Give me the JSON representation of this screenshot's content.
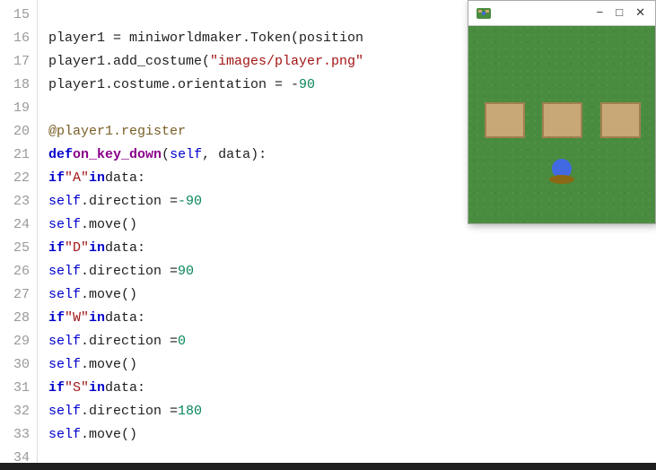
{
  "editor": {
    "lines": [
      {
        "num": "15",
        "content": []
      },
      {
        "num": "16",
        "content": [
          {
            "type": "plain",
            "text": "player1 = miniworldmaker.Token(position"
          }
        ]
      },
      {
        "num": "17",
        "content": [
          {
            "type": "plain",
            "text": "player1.add_costume("
          },
          {
            "type": "str",
            "text": "\"images/player.png\""
          }
        ]
      },
      {
        "num": "18",
        "content": [
          {
            "type": "plain",
            "text": "player1.costume.orientation = - "
          },
          {
            "type": "num",
            "text": "90"
          }
        ]
      },
      {
        "num": "19",
        "content": []
      },
      {
        "num": "20",
        "content": [
          {
            "type": "decorator",
            "text": "@player1.register"
          }
        ]
      },
      {
        "num": "21",
        "content": [
          {
            "type": "kw",
            "text": "def "
          },
          {
            "type": "fn",
            "text": "on_key_down"
          },
          {
            "type": "plain",
            "text": "("
          },
          {
            "type": "self-kw",
            "text": "self"
          },
          {
            "type": "plain",
            "text": ", data):"
          }
        ]
      },
      {
        "num": "22",
        "content": [
          {
            "type": "plain",
            "text": "    "
          },
          {
            "type": "kw",
            "text": "if "
          },
          {
            "type": "str",
            "text": "\"A\""
          },
          {
            "type": "kw",
            "text": " in "
          },
          {
            "type": "plain",
            "text": "data:"
          }
        ]
      },
      {
        "num": "23",
        "content": [
          {
            "type": "plain",
            "text": "        "
          },
          {
            "type": "self-kw",
            "text": "self"
          },
          {
            "type": "plain",
            "text": ".direction = "
          },
          {
            "type": "num",
            "text": "-90"
          }
        ]
      },
      {
        "num": "24",
        "content": [
          {
            "type": "plain",
            "text": "        "
          },
          {
            "type": "self-kw",
            "text": "self"
          },
          {
            "type": "plain",
            "text": ".move()"
          }
        ]
      },
      {
        "num": "25",
        "content": [
          {
            "type": "plain",
            "text": "    "
          },
          {
            "type": "kw",
            "text": "if "
          },
          {
            "type": "str",
            "text": "\"D\""
          },
          {
            "type": "kw",
            "text": " in "
          },
          {
            "type": "plain",
            "text": "data:"
          }
        ]
      },
      {
        "num": "26",
        "content": [
          {
            "type": "plain",
            "text": "        "
          },
          {
            "type": "self-kw",
            "text": "self"
          },
          {
            "type": "plain",
            "text": ".direction = "
          },
          {
            "type": "num",
            "text": "90"
          }
        ]
      },
      {
        "num": "27",
        "content": [
          {
            "type": "plain",
            "text": "        "
          },
          {
            "type": "self-kw",
            "text": "self"
          },
          {
            "type": "plain",
            "text": ".move()"
          }
        ]
      },
      {
        "num": "28",
        "content": [
          {
            "type": "plain",
            "text": "    "
          },
          {
            "type": "kw",
            "text": "if "
          },
          {
            "type": "str",
            "text": "\"W\""
          },
          {
            "type": "kw",
            "text": " in "
          },
          {
            "type": "plain",
            "text": "data:"
          }
        ]
      },
      {
        "num": "29",
        "content": [
          {
            "type": "plain",
            "text": "        "
          },
          {
            "type": "self-kw",
            "text": "self"
          },
          {
            "type": "plain",
            "text": ".direction = "
          },
          {
            "type": "num",
            "text": "0"
          }
        ]
      },
      {
        "num": "30",
        "content": [
          {
            "type": "plain",
            "text": "        "
          },
          {
            "type": "self-kw",
            "text": "self"
          },
          {
            "type": "plain",
            "text": ".move()"
          }
        ]
      },
      {
        "num": "31",
        "content": [
          {
            "type": "plain",
            "text": "    "
          },
          {
            "type": "kw",
            "text": "if "
          },
          {
            "type": "str",
            "text": "\"S\""
          },
          {
            "type": "kw",
            "text": " in "
          },
          {
            "type": "plain",
            "text": "data:"
          }
        ]
      },
      {
        "num": "32",
        "content": [
          {
            "type": "plain",
            "text": "        "
          },
          {
            "type": "self-kw",
            "text": "self"
          },
          {
            "type": "plain",
            "text": ".direction = "
          },
          {
            "type": "num",
            "text": "180"
          }
        ]
      },
      {
        "num": "33",
        "content": [
          {
            "type": "plain",
            "text": "        "
          },
          {
            "type": "self-kw",
            "text": "self"
          },
          {
            "type": "plain",
            "text": ".move()"
          }
        ]
      },
      {
        "num": "34",
        "content": []
      }
    ]
  },
  "miniWindow": {
    "title": "",
    "controls": {
      "minimize": "−",
      "maximize": "□",
      "close": "✕"
    }
  }
}
